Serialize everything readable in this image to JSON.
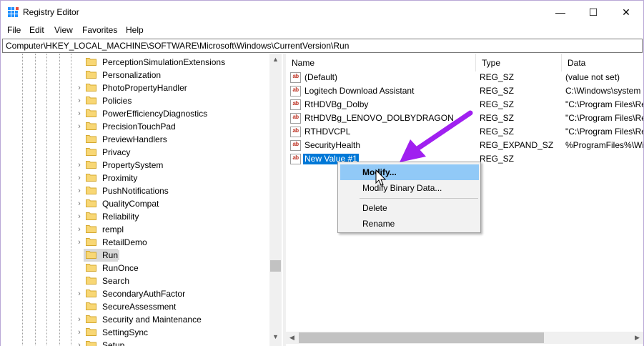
{
  "window": {
    "title": "Registry Editor",
    "minimize_glyph": "—",
    "maximize_glyph": "☐",
    "close_glyph": "✕"
  },
  "menu": [
    "File",
    "Edit",
    "View",
    "Favorites",
    "Help"
  ],
  "address": "Computer\\HKEY_LOCAL_MACHINE\\SOFTWARE\\Microsoft\\Windows\\CurrentVersion\\Run",
  "tree": {
    "items": [
      {
        "label": "PerceptionSimulationExtensions",
        "expandable": false
      },
      {
        "label": "Personalization",
        "expandable": false
      },
      {
        "label": "PhotoPropertyHandler",
        "expandable": true
      },
      {
        "label": "Policies",
        "expandable": true
      },
      {
        "label": "PowerEfficiencyDiagnostics",
        "expandable": true
      },
      {
        "label": "PrecisionTouchPad",
        "expandable": true
      },
      {
        "label": "PreviewHandlers",
        "expandable": false
      },
      {
        "label": "Privacy",
        "expandable": false
      },
      {
        "label": "PropertySystem",
        "expandable": true
      },
      {
        "label": "Proximity",
        "expandable": true
      },
      {
        "label": "PushNotifications",
        "expandable": true
      },
      {
        "label": "QualityCompat",
        "expandable": true
      },
      {
        "label": "Reliability",
        "expandable": true
      },
      {
        "label": "rempl",
        "expandable": true
      },
      {
        "label": "RetailDemo",
        "expandable": true
      },
      {
        "label": "Run",
        "expandable": false,
        "selected": true
      },
      {
        "label": "RunOnce",
        "expandable": false
      },
      {
        "label": "Search",
        "expandable": false
      },
      {
        "label": "SecondaryAuthFactor",
        "expandable": true
      },
      {
        "label": "SecureAssessment",
        "expandable": false
      },
      {
        "label": "Security and Maintenance",
        "expandable": true
      },
      {
        "label": "SettingSync",
        "expandable": true
      },
      {
        "label": "Setup",
        "expandable": true
      }
    ]
  },
  "list": {
    "headers": {
      "name": "Name",
      "type": "Type",
      "data": "Data"
    },
    "rows": [
      {
        "name": "(Default)",
        "type": "REG_SZ",
        "data": "(value not set)"
      },
      {
        "name": "Logitech Download Assistant",
        "type": "REG_SZ",
        "data": "C:\\Windows\\system"
      },
      {
        "name": "RtHDVBg_Dolby",
        "type": "REG_SZ",
        "data": "\"C:\\Program Files\\Re"
      },
      {
        "name": "RtHDVBg_LENOVO_DOLBYDRAGON",
        "type": "REG_SZ",
        "data": "\"C:\\Program Files\\Re"
      },
      {
        "name": "RTHDVCPL",
        "type": "REG_SZ",
        "data": "\"C:\\Program Files\\Re"
      },
      {
        "name": "SecurityHealth",
        "type": "REG_EXPAND_SZ",
        "data": "%ProgramFiles%\\Wi"
      },
      {
        "name": "New Value #1",
        "type": "REG_SZ",
        "data": "",
        "selected": true
      }
    ],
    "value_icon_text": "ab"
  },
  "context_menu": {
    "items": [
      "Modify...",
      "Modify Binary Data...",
      "Delete",
      "Rename"
    ],
    "highlighted": "Modify..."
  },
  "annotation_color": "#a020f0",
  "icons": {
    "app": "registry-editor-icon",
    "folder": "folder-icon",
    "value": "string-value-icon",
    "cursor": "mouse-cursor-icon"
  }
}
